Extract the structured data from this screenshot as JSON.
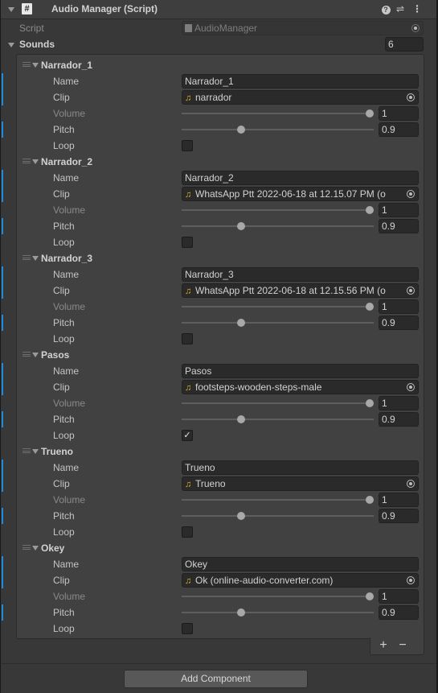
{
  "component": {
    "title": "Audio Manager (Script)",
    "script_label": "Script",
    "script_value": "AudioManager"
  },
  "sounds": {
    "label": "Sounds",
    "count": "6",
    "items": [
      {
        "header": "Narrador_1",
        "name": "Narrador_1",
        "clip": "narrador",
        "volume": 1,
        "volume_text": "1",
        "pitch": 0.9,
        "pitch_text": "0.9",
        "loop": false
      },
      {
        "header": "Narrador_2",
        "name": "Narrador_2",
        "clip": "WhatsApp Ptt 2022-06-18 at 12.15.07 PM (o",
        "volume": 1,
        "volume_text": "1",
        "pitch": 0.9,
        "pitch_text": "0.9",
        "loop": false
      },
      {
        "header": "Narrador_3",
        "name": "Narrador_3",
        "clip": "WhatsApp Ptt 2022-06-18 at 12.15.56 PM (o",
        "volume": 1,
        "volume_text": "1",
        "pitch": 0.9,
        "pitch_text": "0.9",
        "loop": false
      },
      {
        "header": "Pasos",
        "name": "Pasos",
        "clip": "footsteps-wooden-steps-male",
        "volume": 1,
        "volume_text": "1",
        "pitch": 0.9,
        "pitch_text": "0.9",
        "loop": true
      },
      {
        "header": "Trueno",
        "name": "Trueno",
        "clip": "Trueno",
        "volume": 1,
        "volume_text": "1",
        "pitch": 0.9,
        "pitch_text": "0.9",
        "loop": false
      },
      {
        "header": "Okey",
        "name": "Okey",
        "clip": "Ok (online-audio-converter.com)",
        "volume": 1,
        "volume_text": "1",
        "pitch": 0.9,
        "pitch_text": "0.9",
        "loop": false
      }
    ]
  },
  "labels": {
    "name": "Name",
    "clip": "Clip",
    "volume": "Volume",
    "pitch": "Pitch",
    "loop": "Loop"
  },
  "list_buttons": {
    "add": "+",
    "remove": "−"
  },
  "add_component": "Add Component",
  "icons": {
    "header_script": "script-hash-icon",
    "help": "help-icon",
    "presets": "presets-icon",
    "menu": "kebab-menu-icon",
    "clip": "audio-clip-note-icon",
    "picker": "object-picker-icon"
  },
  "colors": {
    "accent_modified": "#1d8bd8",
    "clip_icon": "#e0b020",
    "background": "#383838"
  }
}
